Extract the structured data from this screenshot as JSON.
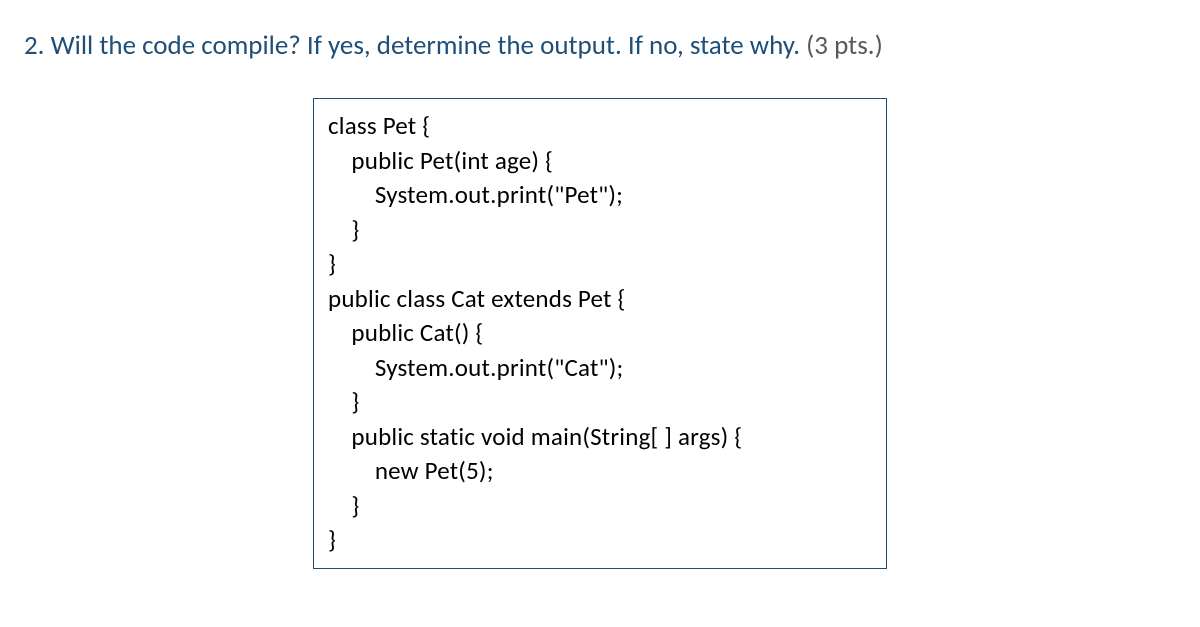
{
  "question": {
    "number": "2.",
    "text": "Will the code compile? If yes, determine the output. If no, state why.",
    "points": "(3 pts.)"
  },
  "code": {
    "lines": [
      "class Pet {",
      "    public Pet(int age) {",
      "        System.out.print(\"Pet\");",
      "    }",
      "}",
      "public class Cat extends Pet {",
      "    public Cat() {",
      "        System.out.print(\"Cat\");",
      "    }",
      "    public static void main(String[ ] args) {",
      "        new Pet(5);",
      "    }",
      "}"
    ]
  }
}
